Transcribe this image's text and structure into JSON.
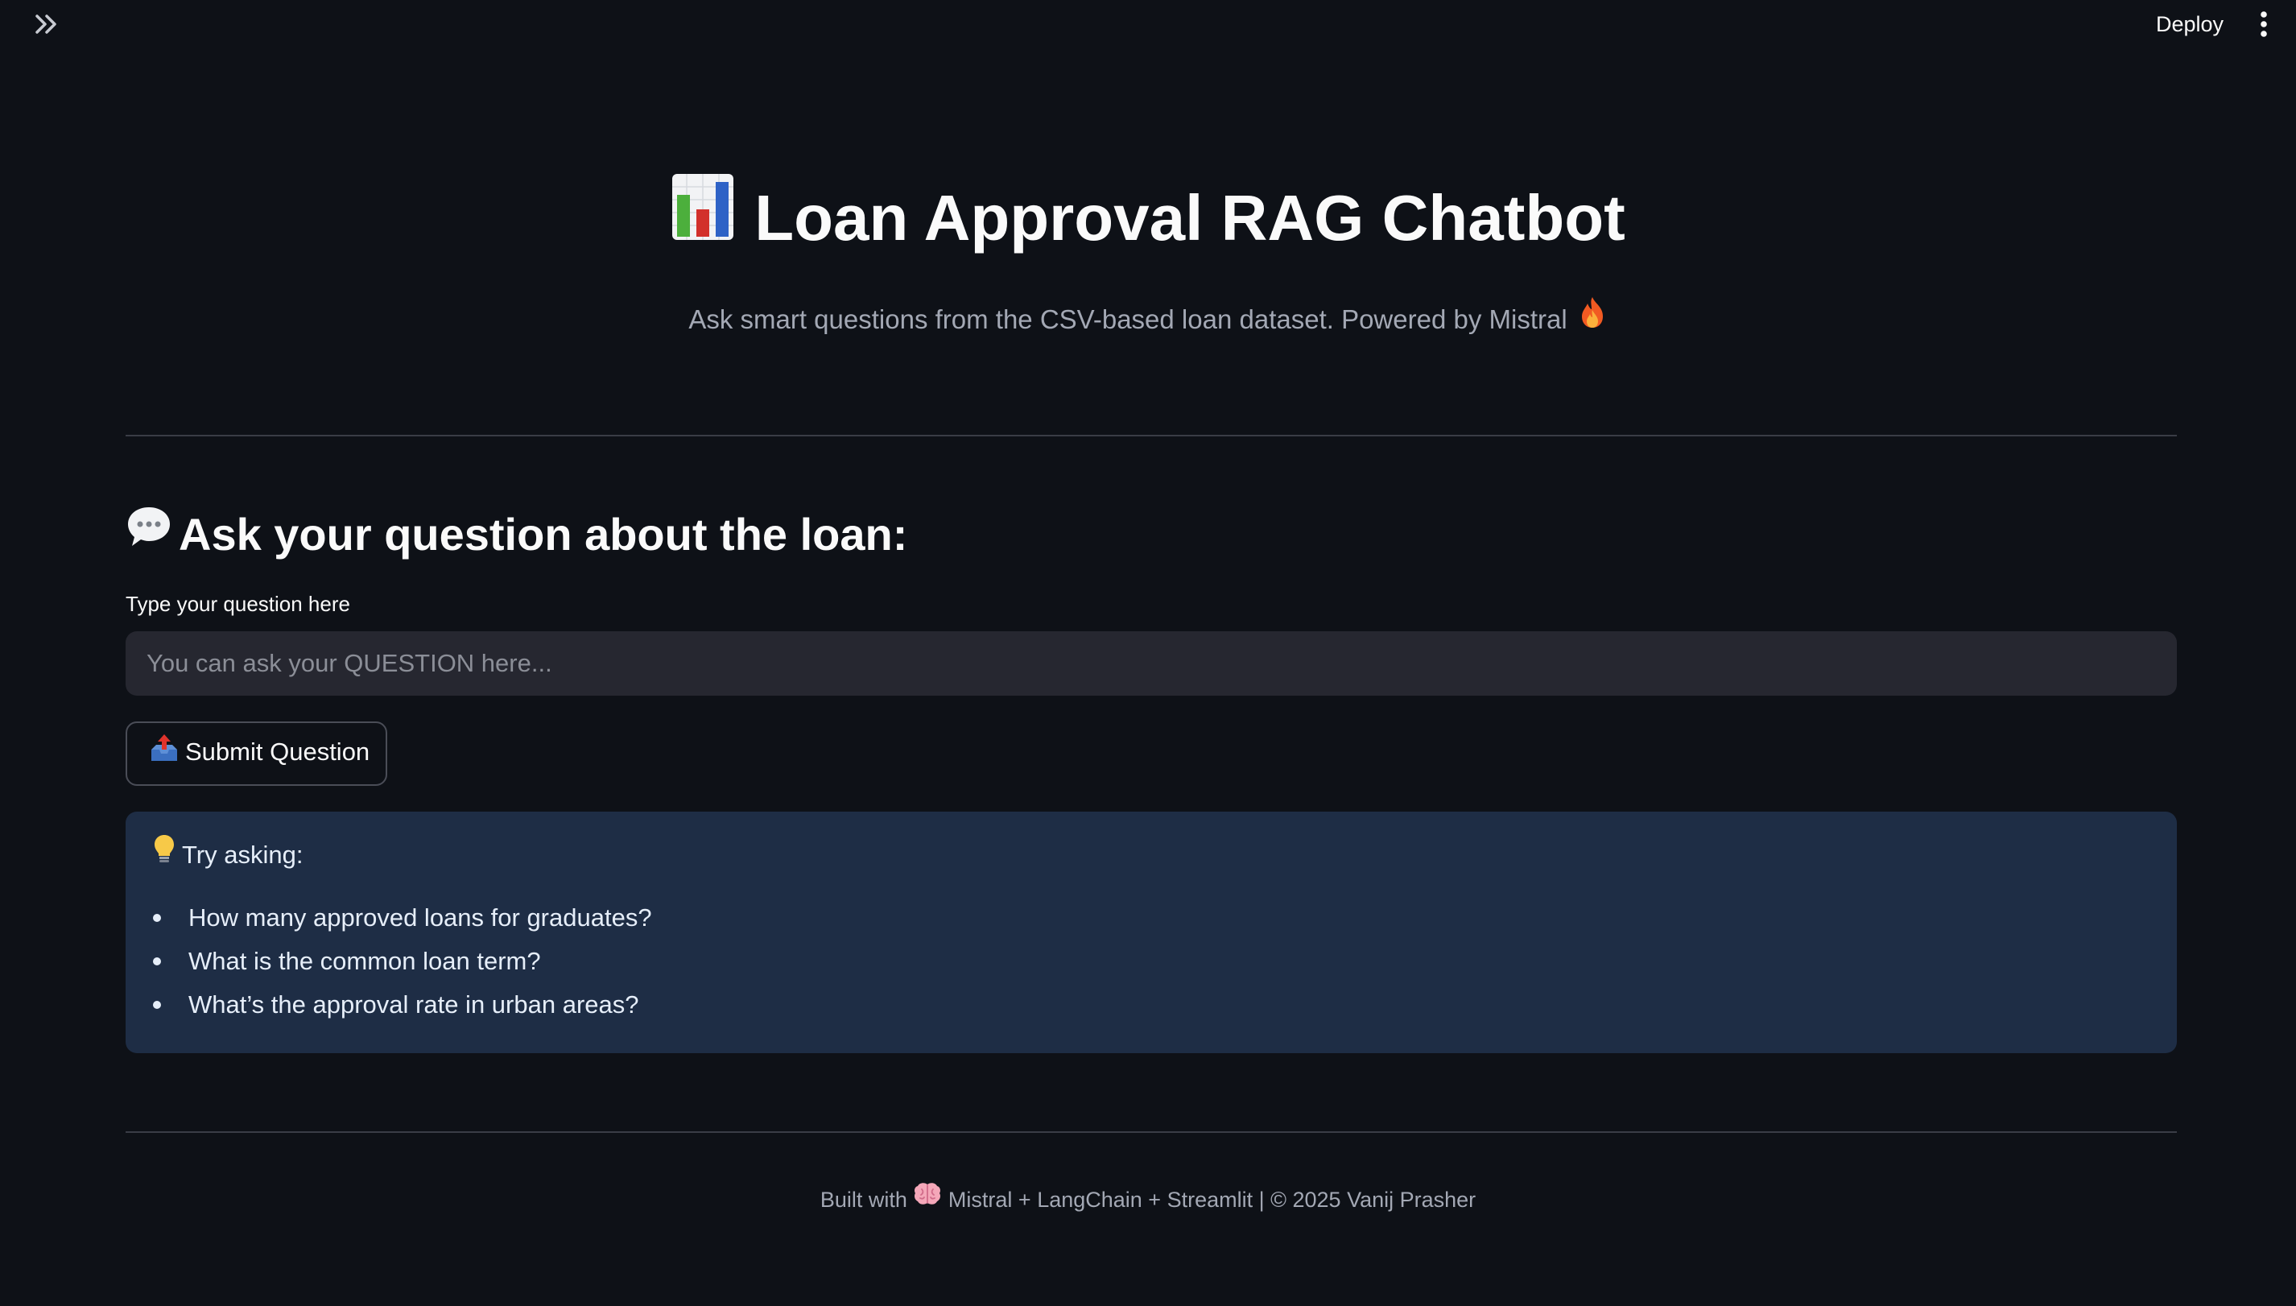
{
  "toolbar": {
    "deploy_label": "Deploy"
  },
  "header": {
    "title": "Loan Approval RAG Chatbot",
    "title_icon": "bar-chart-icon",
    "subtitle": "Ask smart questions from the CSV-based loan dataset. Powered by Mistral",
    "subtitle_icon": "fire-icon"
  },
  "ask": {
    "heading": "Ask your question about the loan:",
    "heading_icon": "speech-bubble-icon",
    "input_label": "Type your question here",
    "input_placeholder": "You can ask your QUESTION here...",
    "input_value": "",
    "submit_label": "Submit Question",
    "submit_icon": "outbox-tray-icon"
  },
  "info": {
    "heading": "Try asking:",
    "heading_icon": "light-bulb-icon",
    "suggestions": [
      "How many approved loans for graduates?",
      "What is the common loan term?",
      "What’s the approval rate in urban areas?"
    ]
  },
  "footer": {
    "prefix": "Built with",
    "icon": "brain-icon",
    "suffix": "Mistral + LangChain + Streamlit | © 2025 Vanij Prasher"
  },
  "colors": {
    "background": "#0e1117",
    "input_background": "#262730",
    "info_background": "#1e2d45",
    "muted_text": "#a3a8b4",
    "divider": "#3a3d46"
  }
}
